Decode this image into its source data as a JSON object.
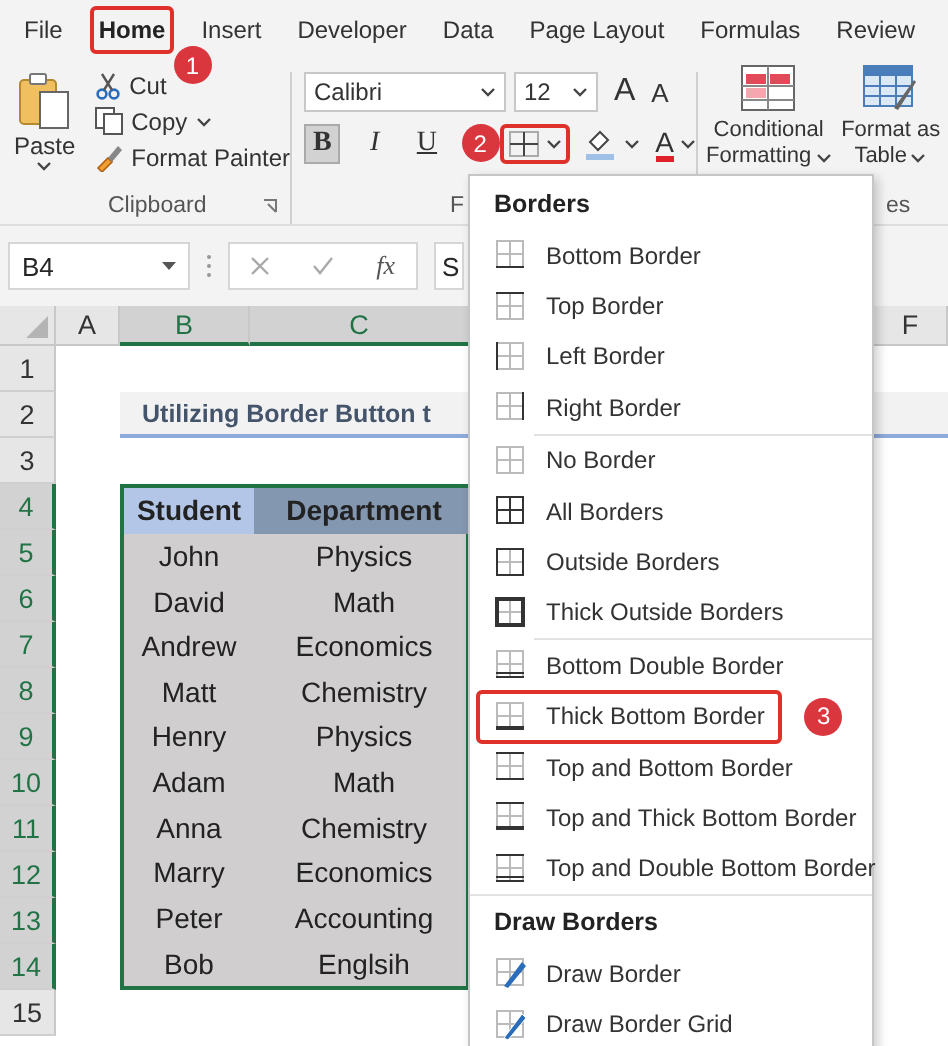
{
  "tabs": [
    {
      "label": "File",
      "selected": false,
      "highlighted": false
    },
    {
      "label": "Home",
      "selected": true,
      "highlighted": true,
      "callout": "1"
    },
    {
      "label": "Insert",
      "selected": false,
      "highlighted": false
    },
    {
      "label": "Developer",
      "selected": false,
      "highlighted": false
    },
    {
      "label": "Data",
      "selected": false,
      "highlighted": false
    },
    {
      "label": "Page Layout",
      "selected": false,
      "highlighted": false
    },
    {
      "label": "Formulas",
      "selected": false,
      "highlighted": false
    },
    {
      "label": "Review",
      "selected": false,
      "highlighted": false
    }
  ],
  "clipboard": {
    "paste": "Paste",
    "cut": "Cut",
    "copy": "Copy",
    "format_painter": "Format Painter",
    "label": "Clipboard"
  },
  "font": {
    "name": "Calibri",
    "size": "12",
    "grow": "A",
    "shrink": "A",
    "format_buttons": [
      {
        "label": "B",
        "kind": "bold",
        "on": true
      },
      {
        "label": "I",
        "kind": "italic",
        "on": false
      },
      {
        "label": "U",
        "kind": "underline",
        "on": false
      }
    ],
    "borders_highlighted": true,
    "borders_callout": "2",
    "font_color": "A",
    "label": "F"
  },
  "styles": {
    "conditional": [
      "Conditional",
      "Formatting"
    ],
    "format_table": [
      "Format as",
      "Table"
    ],
    "label": "es"
  },
  "formula_bar": {
    "name_box": "B4",
    "function_label": "fx",
    "formula": "S"
  },
  "sheet": {
    "columns": [
      {
        "label": "A",
        "selected": false
      },
      {
        "label": "B",
        "selected": true
      },
      {
        "label": "C",
        "selected": true
      },
      {
        "label": "F",
        "selected": false
      }
    ],
    "rows": [
      {
        "label": "1",
        "selected": false
      },
      {
        "label": "2",
        "selected": false
      },
      {
        "label": "3",
        "selected": false
      },
      {
        "label": "4",
        "selected": true
      },
      {
        "label": "5",
        "selected": true
      },
      {
        "label": "6",
        "selected": true
      },
      {
        "label": "7",
        "selected": true
      },
      {
        "label": "8",
        "selected": true
      },
      {
        "label": "9",
        "selected": true
      },
      {
        "label": "10",
        "selected": true
      },
      {
        "label": "11",
        "selected": true
      },
      {
        "label": "12",
        "selected": true
      },
      {
        "label": "13",
        "selected": true
      },
      {
        "label": "14",
        "selected": true
      },
      {
        "label": "15",
        "selected": false
      }
    ],
    "title": "Utilizing Border Button t",
    "table": {
      "columns": [
        "Student",
        "Department"
      ],
      "rows": [
        [
          "John",
          "Physics"
        ],
        [
          "David",
          "Math"
        ],
        [
          "Andrew",
          "Economics"
        ],
        [
          "Matt",
          "Chemistry"
        ],
        [
          "Henry",
          "Physics"
        ],
        [
          "Adam",
          "Math"
        ],
        [
          "Anna",
          "Chemistry"
        ],
        [
          "Marry",
          "Economics"
        ],
        [
          "Peter",
          "Accounting"
        ],
        [
          "Bob",
          "Englsih"
        ]
      ]
    }
  },
  "menu": {
    "sections": [
      {
        "title": "Borders",
        "groups": [
          {
            "items": [
              {
                "label": "Bottom Border",
                "kind": "bottom",
                "highlighted": false
              },
              {
                "label": "Top Border",
                "kind": "top",
                "highlighted": false
              },
              {
                "label": "Left Border",
                "kind": "left",
                "highlighted": false
              },
              {
                "label": "Right Border",
                "kind": "right",
                "highlighted": false
              }
            ]
          },
          {
            "items": [
              {
                "label": "No Border",
                "kind": "none",
                "highlighted": false
              },
              {
                "label": "All Borders",
                "kind": "all",
                "highlighted": false
              },
              {
                "label": "Outside Borders",
                "kind": "outside",
                "highlighted": false
              },
              {
                "label": "Thick Outside Borders",
                "kind": "thick-outside",
                "highlighted": false
              }
            ]
          },
          {
            "items": [
              {
                "label": "Bottom Double Border",
                "kind": "bottom-double",
                "highlighted": false
              },
              {
                "label": "Thick Bottom Border",
                "kind": "thick-bottom",
                "highlighted": true,
                "callout": "3"
              },
              {
                "label": "Top and Bottom Border",
                "kind": "top-bottom",
                "highlighted": false
              },
              {
                "label": "Top and Thick Bottom Border",
                "kind": "top-thick-bottom",
                "highlighted": false
              },
              {
                "label": "Top and Double Bottom Border",
                "kind": "top-double-bottom",
                "highlighted": false
              }
            ]
          }
        ]
      },
      {
        "title": "Draw Borders",
        "groups": [
          {
            "items": [
              {
                "label": "Draw Border",
                "kind": "draw",
                "highlighted": false
              },
              {
                "label": "Draw Border Grid",
                "kind": "draw-grid",
                "highlighted": false
              }
            ]
          }
        ]
      }
    ]
  }
}
